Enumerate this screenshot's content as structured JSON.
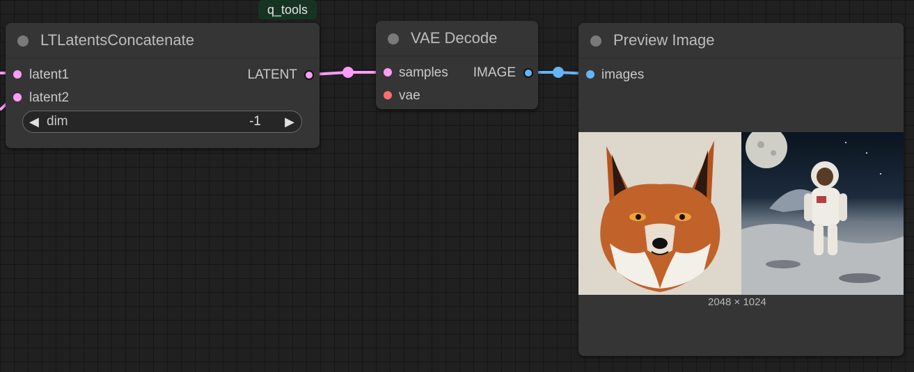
{
  "group_badge": "q_tools",
  "nodes": {
    "concat": {
      "title": "LTLatentsConcatenate",
      "inputs": [
        "latent1",
        "latent2"
      ],
      "output": "LATENT",
      "widget": {
        "name": "dim",
        "value": "-1",
        "left_arrow": "◀",
        "right_arrow": "▶"
      }
    },
    "vae_decode": {
      "title": "VAE Decode",
      "inputs": [
        "samples",
        "vae"
      ],
      "output": "IMAGE"
    },
    "preview": {
      "title": "Preview Image",
      "inputs": [
        "images"
      ],
      "image_size": "2048 × 1024",
      "image_panels": [
        "fox illustration",
        "astronaut on the moon"
      ]
    }
  },
  "colors": {
    "latent": "#ff9cf9",
    "image": "#64b5f6",
    "vae": "#ff6e6e",
    "node_bg": "#353535",
    "canvas_bg": "#202020"
  }
}
